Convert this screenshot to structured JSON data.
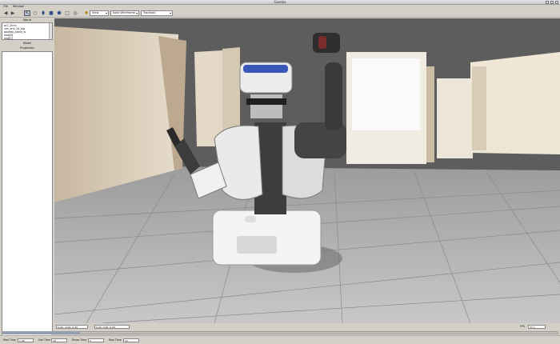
{
  "window": {
    "title": "Gazebo"
  },
  "menu": {
    "items": [
      "File",
      "Window"
    ]
  },
  "toolbar": {
    "buttons": [
      {
        "name": "back-icon",
        "glyph": "◀"
      },
      {
        "name": "forward-icon",
        "glyph": "▶"
      },
      {
        "name": "select-icon",
        "glyph": "⇱"
      },
      {
        "name": "sphere-icon",
        "glyph": "○"
      },
      {
        "name": "cylinder-icon",
        "glyph": "⬮"
      },
      {
        "name": "box-icon",
        "glyph": "■"
      },
      {
        "name": "shield-icon",
        "glyph": "⬟"
      },
      {
        "name": "square-icon",
        "glyph": "□"
      },
      {
        "name": "ring-icon",
        "glyph": "◎"
      },
      {
        "name": "light-icon",
        "glyph": "✹"
      }
    ],
    "view_select": "View",
    "render_select": "Solid Wireframe",
    "camera_select": "Trackball"
  },
  "left_panel": {
    "world_tab": "World",
    "tree_items": [
      "pr2_2mm",
      "sim_env_10_big",
      "gazebo_plane_w",
      "wall[0]",
      "wall[1]"
    ],
    "model_label": "Model",
    "properties_label": "Properties"
  },
  "viewport": {
    "footer": {
      "fps_label": "FPS",
      "fps_value": "37.1",
      "pose_value": "0.00, -0.00, 0.00",
      "orient_value": "0.00, 0.00, 0.00"
    }
  },
  "progress": {
    "value": 0.14
  },
  "status": {
    "items": [
      {
        "label": "Real Time",
        "value": "1.00"
      },
      {
        "label": "Sim Time",
        "value": "10"
      },
      {
        "label": "Pause Time",
        "value": "0"
      },
      {
        "label": "Real Time",
        "value": "12"
      }
    ]
  }
}
